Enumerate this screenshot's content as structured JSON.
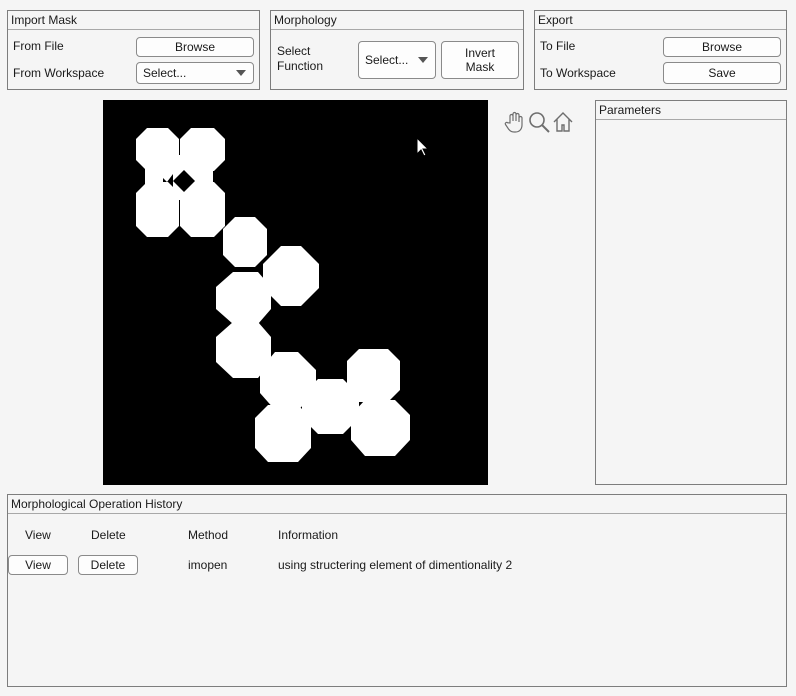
{
  "import_panel": {
    "title": "Import Mask",
    "from_file_label": "From File",
    "browse_label": "Browse",
    "from_workspace_label": "From Workspace",
    "workspace_select_value": "Select..."
  },
  "morphology_panel": {
    "title": "Morphology",
    "select_function_label": "Select\nFunction",
    "function_select_value": "Select...",
    "invert_label": "Invert\nMask"
  },
  "export_panel": {
    "title": "Export",
    "to_file_label": "To File",
    "browse_label": "Browse",
    "to_workspace_label": "To Workspace",
    "save_label": "Save"
  },
  "parameters_panel": {
    "title": "Parameters"
  },
  "axes_toolbar": {
    "icons": [
      "pan-icon",
      "zoom-icon",
      "home-icon"
    ]
  },
  "colors": {
    "mask_background": "#000000",
    "mask_foreground": "#ffffff",
    "panel_bg": "#f5f5f5"
  },
  "history": {
    "title": "Morphological Operation History",
    "columns": [
      "View",
      "Delete",
      "Method",
      "Information"
    ],
    "rows": [
      {
        "view_label": "View",
        "delete_label": "Delete",
        "method": "imopen",
        "information": "using structering element of dimentionality 2"
      }
    ]
  }
}
